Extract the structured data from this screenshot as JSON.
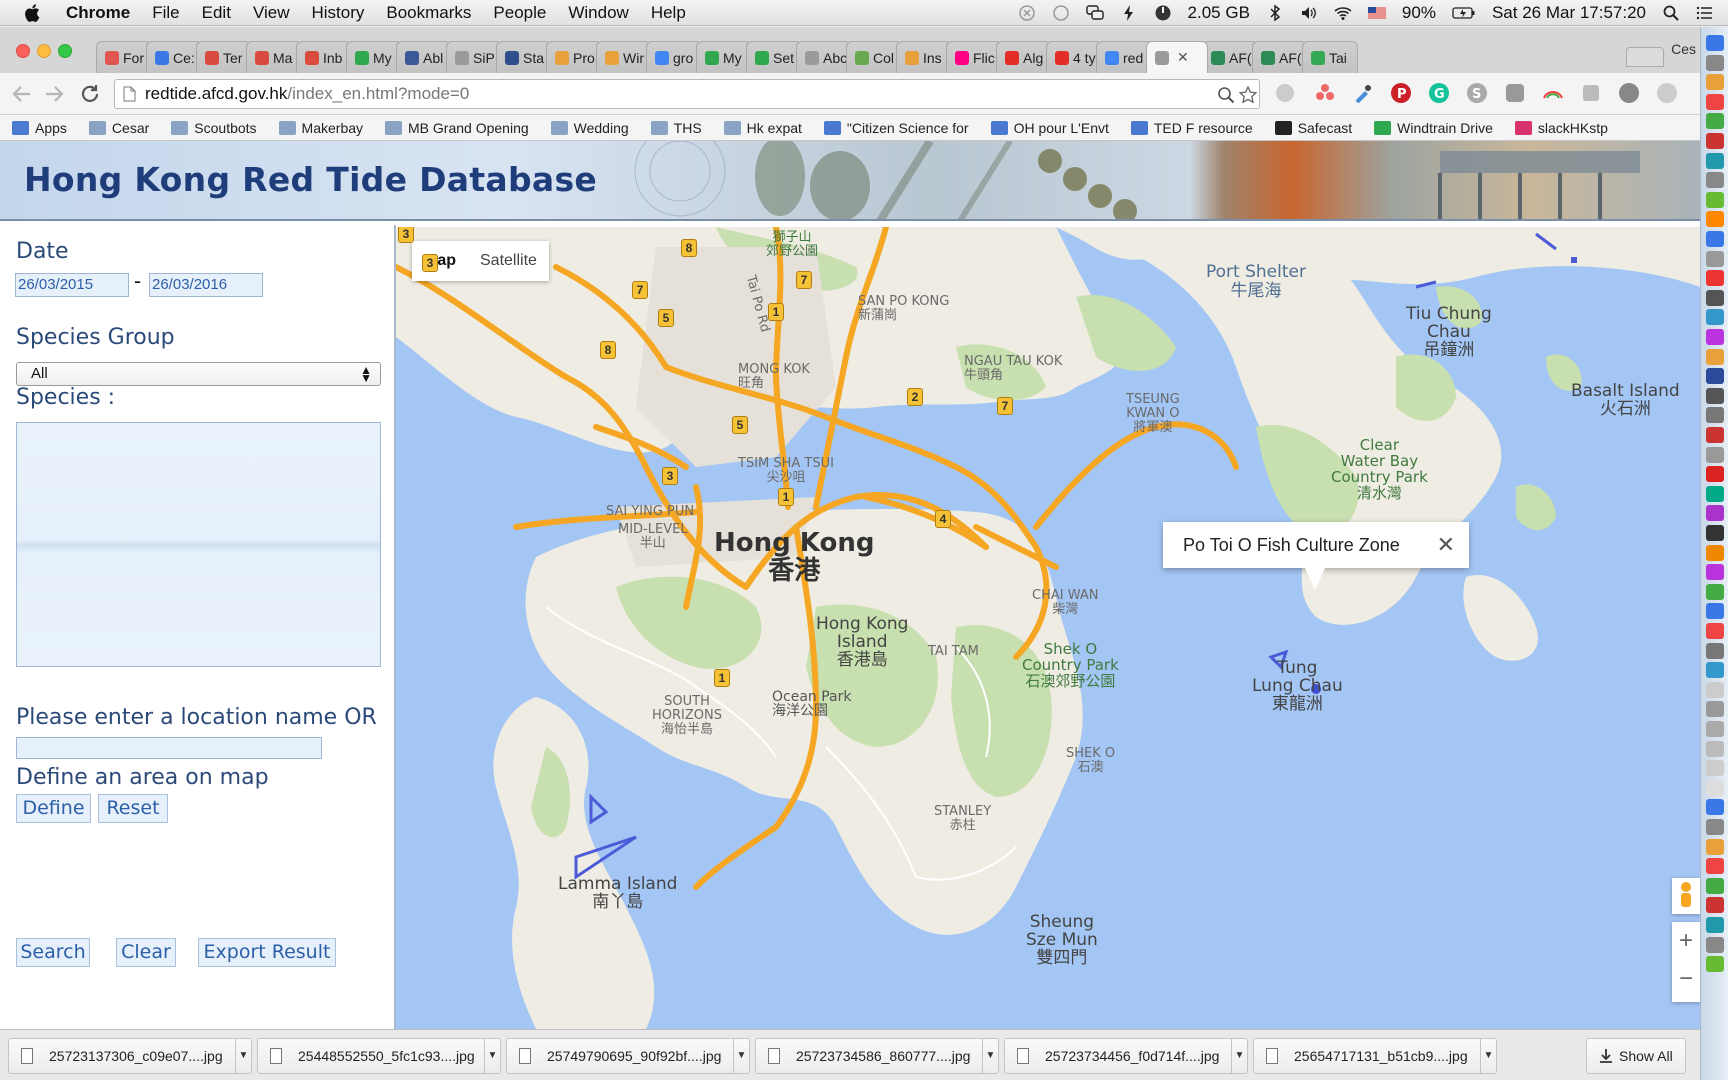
{
  "menubar": {
    "app": "Chrome",
    "items": [
      "File",
      "Edit",
      "View",
      "History",
      "Bookmarks",
      "People",
      "Window",
      "Help"
    ],
    "memory": "2.05 GB",
    "battery": "90%",
    "datetime": "Sat 26 Mar  17:57:20"
  },
  "tabs": [
    {
      "label": "For",
      "color": "#e0574f"
    },
    {
      "label": "Ce:",
      "color": "#3b78e7"
    },
    {
      "label": "Ter",
      "color": "#d84b3e"
    },
    {
      "label": "Ma",
      "color": "#d84b3e"
    },
    {
      "label": "Inb",
      "color": "#d84b3e"
    },
    {
      "label": "My",
      "color": "#2fa84f"
    },
    {
      "label": "Abl",
      "color": "#3b5998"
    },
    {
      "label": "SiP",
      "color": "#9a9a9a"
    },
    {
      "label": "Sta",
      "color": "#2e4e8c"
    },
    {
      "label": "Pro",
      "color": "#e8a13a"
    },
    {
      "label": "Wir",
      "color": "#e8a13a"
    },
    {
      "label": "gro",
      "color": "#4285f4"
    },
    {
      "label": "My",
      "color": "#2fa84f"
    },
    {
      "label": "Set",
      "color": "#2fa84f"
    },
    {
      "label": "Abc",
      "color": "#9a9a9a"
    },
    {
      "label": "Col",
      "color": "#6aa84f"
    },
    {
      "label": "Ins",
      "color": "#e8a13a"
    },
    {
      "label": "Flic",
      "color": "#ff0084"
    },
    {
      "label": "Alg",
      "color": "#e52d27"
    },
    {
      "label": "4 ty",
      "color": "#e52d27"
    },
    {
      "label": "red",
      "color": "#4285f4"
    },
    {
      "label": "",
      "color": "#9a9a9a",
      "active": true
    },
    {
      "label": "AF(",
      "color": "#2e8b57"
    },
    {
      "label": "AF(",
      "color": "#2e8b57"
    },
    {
      "label": "Tai",
      "color": "#34a853"
    }
  ],
  "profile": "Ces",
  "address": {
    "host": "redtide.afcd.gov.hk",
    "path": "/index_en.html?mode=0"
  },
  "bookmarks": [
    {
      "label": "Apps",
      "type": "apps"
    },
    {
      "label": "Cesar",
      "type": "folder"
    },
    {
      "label": "Scoutbots",
      "type": "folder"
    },
    {
      "label": "Makerbay",
      "type": "folder"
    },
    {
      "label": "MB Grand Opening",
      "type": "folder"
    },
    {
      "label": "Wedding",
      "type": "folder"
    },
    {
      "label": "THS",
      "type": "folder"
    },
    {
      "label": "Hk expat",
      "type": "folder"
    },
    {
      "label": "\"Citizen Science for",
      "type": "doc"
    },
    {
      "label": "OH pour L'Envt",
      "type": "doc"
    },
    {
      "label": "TED F resource",
      "type": "doc"
    },
    {
      "label": "Safecast",
      "type": "site"
    },
    {
      "label": "Windtrain Drive",
      "type": "drive"
    },
    {
      "label": "slackHKstp",
      "type": "slack"
    }
  ],
  "page": {
    "banner_title": "Hong Kong Red Tide Database",
    "date_label": "Date",
    "date_from": "26/03/2015",
    "date_sep": "-",
    "date_to": "26/03/2016",
    "species_group_label": "Species Group",
    "species_group_value": "All",
    "species_label": "Species :",
    "location_label": "Please enter a location name OR",
    "define_label": "Define an area on map",
    "define_btn": "Define",
    "reset_btn": "Reset",
    "search_btn": "Search",
    "clear_btn": "Clear",
    "export_btn": "Export Result"
  },
  "map": {
    "type_map": "Map",
    "type_satellite": "Satellite",
    "infowindow": "Po Toi O Fish Culture Zone",
    "labels": {
      "port_shelter": "Port Shelter",
      "port_shelter_zh": "牛尾海",
      "tiu_chung": "Tiu Chung",
      "tiu_chung2": "Chau",
      "tiu_chung_zh": "吊鐘洲",
      "basalt": "Basalt Island",
      "basalt_zh": "火石洲",
      "hong_kong": "Hong Kong",
      "hong_kong_zh": "香港",
      "hk_island": "Hong Kong",
      "hk_island2": "Island",
      "hk_island_zh": "香港島",
      "clear_water": "Clear",
      "clear_water2": "Water Bay",
      "clear_water3": "Country Park",
      "clear_water_zh": "清水灣",
      "tung_lung": "Tung",
      "tung_lung2": "Lung Chau",
      "tung_lung_zh": "東龍洲",
      "shek_o_cp": "Shek O",
      "shek_o_cp2": "Country Park",
      "shek_o_cp_zh": "石澳郊野公園",
      "lamma": "Lamma Island",
      "lamma_zh": "南丫島",
      "sheung_sze": "Sheung",
      "sheung_sze2": "Sze Mun",
      "sheung_sze_zh": "雙四門",
      "ocean_park": "Ocean Park",
      "ocean_park_zh": "海洋公園",
      "mong_kok": "MONG KOK",
      "mong_kok_zh": "旺角",
      "san_po_kong": "SAN PO KONG",
      "san_po_kong_zh": "新蒲崗",
      "ngau_tau_kok": "NGAU TAU KOK",
      "ngau_tau_kok_zh": "牛頭角",
      "tseung_kwan_o": "TSEUNG",
      "tseung_kwan_o2": "KWAN O",
      "tseung_kwan_o_zh": "將軍澳",
      "tsim_sha_tsui": "TSIM SHA TSUI",
      "tsim_sha_tsui_zh": "尖沙咀",
      "sai_ying_pun": "SAI YING PUN",
      "mid_level": "MID-LEVEL",
      "mid_level_zh": "半山",
      "chai_wan": "CHAI WAN",
      "chai_wan_zh": "柴灣",
      "south_horizons": "SOUTH",
      "south_horizons2": "HORIZONS",
      "south_horizons_zh": "海怡半島",
      "tai_tam": "TAI TAM",
      "shek_o": "SHEK O",
      "shek_o_zh": "石澳",
      "stanley": "STANLEY",
      "stanley_zh": "赤柱",
      "tai_po_rd": "Tai Po Rd",
      "top_park_zh": "獅子山",
      "top_park_zh2": "郊野公園"
    },
    "shields": [
      "3",
      "8",
      "7",
      "7",
      "5",
      "8",
      "1",
      "2",
      "7",
      "5",
      "3",
      "1",
      "4",
      "1",
      "3"
    ],
    "zoom_in": "+",
    "zoom_out": "−"
  },
  "downloads": [
    "25723137306_c09e07....jpg",
    "25448552550_5fc1c93....jpg",
    "25749790695_90f92bf....jpg",
    "25723734586_860777....jpg",
    "25723734456_f0d714f....jpg",
    "25654717131_b51cb9....jpg"
  ],
  "show_all": "Show All"
}
